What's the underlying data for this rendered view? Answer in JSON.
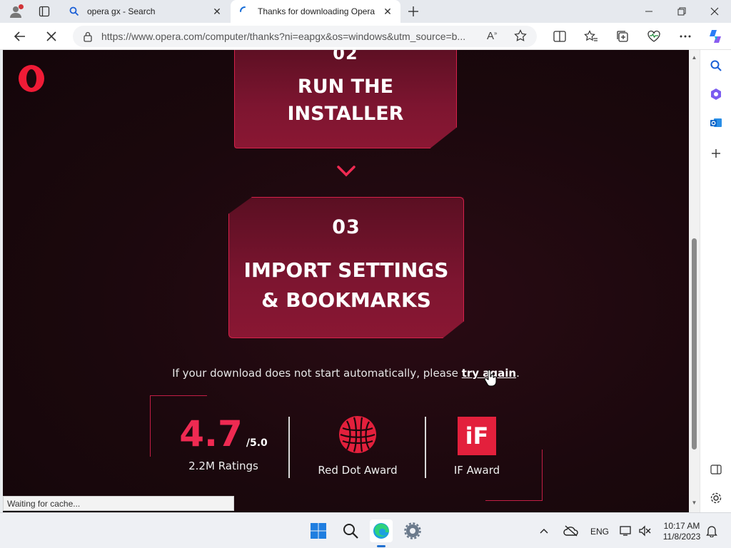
{
  "browser": {
    "tabs": [
      {
        "title": "opera gx - Search",
        "icon": "search-icon",
        "active": false
      },
      {
        "title": "Thanks for downloading Opera",
        "icon": "loading-spinner-icon",
        "active": true
      }
    ],
    "address": "https://www.opera.com/computer/thanks?ni=eapgx&os=windows&utm_source=b..."
  },
  "page": {
    "step2": {
      "number": "02",
      "heading_line1": "RUN THE",
      "heading_line2": "INSTALLER"
    },
    "step3": {
      "number": "03",
      "heading_line1": "IMPORT SETTINGS",
      "heading_line2": "& BOOKMARKS"
    },
    "download_note": {
      "text": "If your download does not start automatically, please",
      "link": "try again",
      "suffix": "."
    },
    "rating": {
      "value": "4.7",
      "scale": "/5.0",
      "label": "2.2M Ratings"
    },
    "awards": [
      {
        "label": "Red Dot Award",
        "icon": "red-dot-award-icon"
      },
      {
        "label": "IF Award",
        "icon": "if-award-icon",
        "logo_text": "iF"
      }
    ],
    "accent_color": "#ef2a52"
  },
  "status_bar": {
    "text": "Waiting for cache..."
  },
  "taskbar": {
    "language": "ENG",
    "time": "10:17 AM",
    "date": "11/8/2023"
  }
}
